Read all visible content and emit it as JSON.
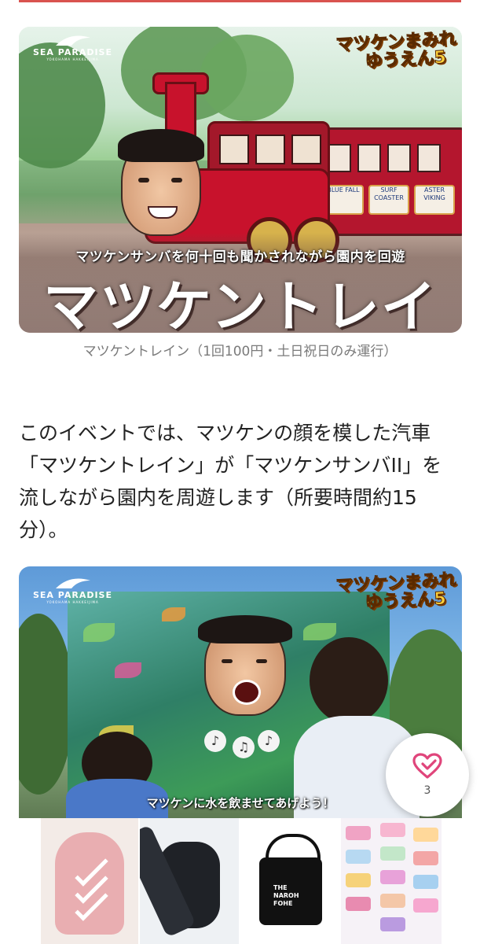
{
  "card1": {
    "brand": "SEA PARADISE",
    "brand_sub": "YOKOHAMA HAKKEIJIMA",
    "logo_line1": "マツケンまみれ",
    "logo_line2": "ゆうえん5",
    "overlay_subtitle": "マツケンサンバを何十回も聞かされながら園内を回遊",
    "overlay_title": "マツケントレイン",
    "coach_signs": [
      "BLUE FALL",
      "SURF COASTER",
      "ASTER VIKING"
    ],
    "caption": "マツケントレイン（1回100円・土日祝日のみ運行）"
  },
  "article": {
    "paragraph": "このイベントでは、マツケンの顔を模した汽車「マツケントレイン」が「マツケンサンバII」を流しながら園内を周遊します（所要時間約15分）。"
  },
  "card2": {
    "brand": "SEA PARADISE",
    "brand_sub": "YOKOHAMA HAKKEIJIMA",
    "logo_line1": "マツケンまみれ",
    "logo_line2": "ゆうえん5",
    "overlay_subtitle": "マツケンに水を飲ませてあげよう！"
  },
  "like": {
    "icon": "heart-icon",
    "count": "3",
    "accent": "#e0457b"
  },
  "ads": {
    "items": [
      {
        "name": "posture-brace"
      },
      {
        "name": "sling-bag"
      },
      {
        "name": "shoulder-bag",
        "label": "THE NAROH FOHE"
      },
      {
        "name": "hair-accessories"
      }
    ]
  }
}
